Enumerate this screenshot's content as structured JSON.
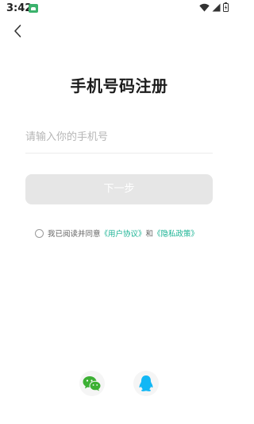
{
  "status_bar": {
    "time": "3:42",
    "icons": [
      "notification-app-icon",
      "wifi-icon",
      "signal-icon",
      "battery-icon"
    ]
  },
  "header": {
    "back_icon": "chevron-left-icon"
  },
  "main": {
    "title": "手机号码注册",
    "phone_placeholder": "请输入你的手机号",
    "next_button_label": "下一步"
  },
  "agreement": {
    "prefix": "我已阅读并同意",
    "user_agreement_link": "《用户协议》",
    "conjunction": "和",
    "privacy_link": "《隐私政策》"
  },
  "social_login": {
    "icons": [
      "wechat-icon",
      "qq-icon"
    ]
  },
  "colors": {
    "accent": "#1ab394",
    "button_disabled": "#e6e6e6",
    "wechat_green": "#3cb034",
    "qq_teal": "#12b7f5"
  }
}
